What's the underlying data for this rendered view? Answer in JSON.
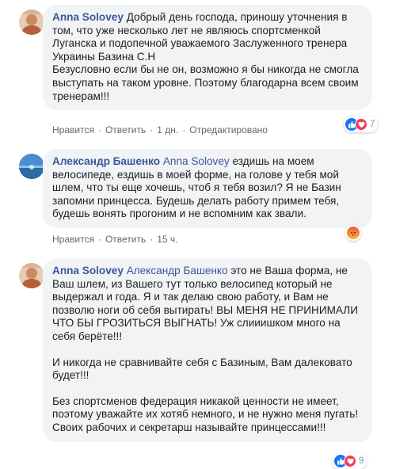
{
  "comments": [
    {
      "author": "Anna Solovey",
      "mention": "",
      "paragraphs": [
        "Добрый день господа, приношу уточнения в том, что уже несколько лет не являюсь спортсменкой Луганска и подопечной уважаемого Заслуженного тренера Украины Базина С.Н",
        "Безусловно если бы не он, возможно я бы никогда не смогла выступать на таком уровне. Поэтому благодарна всем своим тренерам!!!"
      ],
      "like_label": "Нравится",
      "reply_label": "Ответить",
      "time": "1 дн.",
      "edited_label": "Отредактировано",
      "reaction_icons": [
        "like-icon",
        "love-icon"
      ],
      "reaction_count": "7"
    },
    {
      "author": "Александр Башенко",
      "mention": "Anna Solovey",
      "paragraphs": [
        "ездишь на моем велосипеде, ездишь в моей форме, на голове у тебя мой шлем, что ты еще хочешь, чтоб я тебя возил? Я не Базин запомни принцесса. Будешь делать работу примем тебя, будешь вонять прогоним и не вспомним как звали."
      ],
      "like_label": "Нравится",
      "reply_label": "Ответить",
      "time": "15 ч.",
      "edited_label": "",
      "reaction_icons": [
        "angry-icon"
      ],
      "reaction_count": ""
    },
    {
      "author": "Anna Solovey",
      "mention": "Александр Башенко",
      "paragraphs": [
        "это не Ваша форма, не Ваш шлем, из Вашего тут только велосипед который не выдержал и года. Я и так делаю свою работу, и Вам не позволю ноги об себя вытирать! ВЫ МЕНЯ НЕ ПРИНИМАЛИ ЧТО БЫ ГРОЗИТЬСЯ ВЫГНАТЬ! Уж слииишком много на себя берёте!!!",
        "И никогда не сравнивайте себя с Базиным, Вам далековато будет!!!",
        "Без спортсменов федерация никакой ценности не имеет, поэтому уважайте их хотяб немного, и не нужно меня пугать! Своих рабочих и секретарш называйте принцессами!!!"
      ],
      "like_label": "",
      "reply_label": "",
      "time": "",
      "edited_label": "",
      "reaction_icons": [
        "like-icon",
        "love-icon"
      ],
      "reaction_count": "9"
    }
  ],
  "colors": {
    "link": "#385898",
    "bubble": "#f2f3f5",
    "meta": "#616770",
    "like": "#1877f2",
    "love": "#f33e58",
    "angry": "#e9710f"
  }
}
